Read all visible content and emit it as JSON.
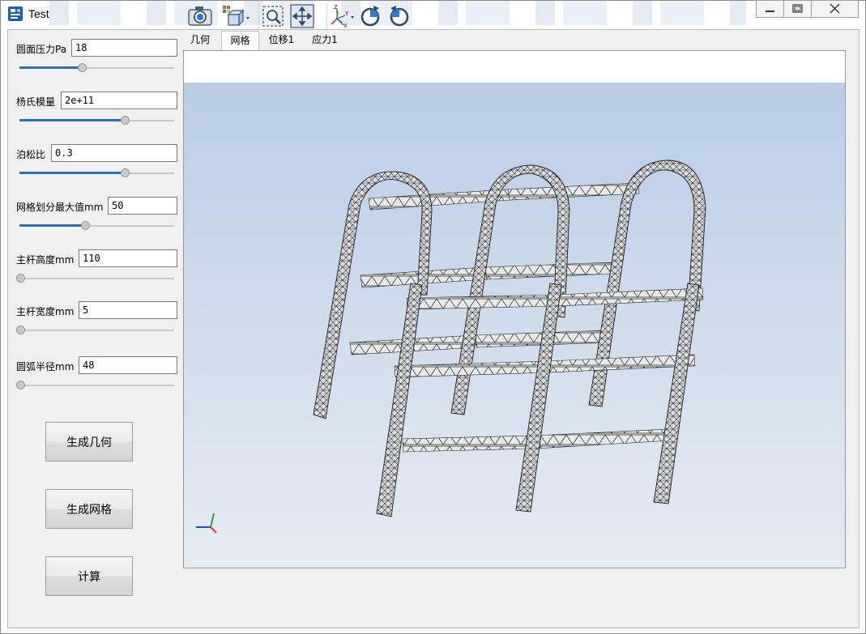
{
  "window": {
    "title": "Test"
  },
  "params": [
    {
      "label": "圆面压力Pa",
      "value": "18",
      "slider": 0.4
    },
    {
      "label": "杨氏模量",
      "value": "2e+11",
      "slider": 0.68
    },
    {
      "label": "泊松比",
      "value": "0.3",
      "slider": 0.68
    },
    {
      "label": "网格划分最大值mm",
      "value": "50",
      "slider": 0.42
    },
    {
      "label": "主杆高度mm",
      "value": "110",
      "slider": 0.0
    },
    {
      "label": "主杆宽度mm",
      "value": "5",
      "slider": 0.0
    },
    {
      "label": "圆弧半径mm",
      "value": "48",
      "slider": 0.0
    }
  ],
  "buttons": {
    "geometry": "生成几何",
    "mesh": "生成网格",
    "compute": "计算"
  },
  "tabs": [
    {
      "label": "几何",
      "active": false
    },
    {
      "label": "网格",
      "active": true
    },
    {
      "label": "位移1",
      "active": false
    },
    {
      "label": "应力1",
      "active": false
    }
  ],
  "toolbar": {
    "icons": [
      "camera-icon",
      "display-mode-icon",
      "zoom-box-icon",
      "fit-all-icon",
      "axes-view-icon",
      "rotate-cw-icon",
      "rotate-ccw-icon"
    ]
  },
  "colors": {
    "slider_accent": "#2b6fb8",
    "viewport_top": "#b9cde5",
    "viewport_bottom": "#e6ebf2",
    "axis_x": "#e53935",
    "axis_y": "#2e9e3a",
    "axis_z": "#1e4fd6"
  }
}
